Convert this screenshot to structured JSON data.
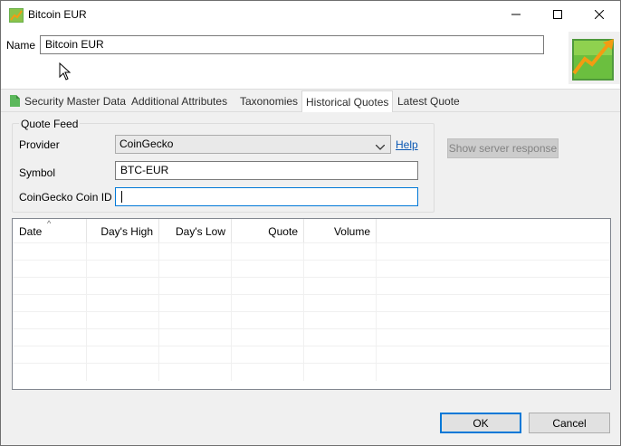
{
  "window": {
    "title": "Bitcoin EUR",
    "app_icon": "chart-icon",
    "controls": [
      "minimize-icon",
      "maximize-icon",
      "close-icon"
    ]
  },
  "header": {
    "name_label": "Name",
    "name_value": "Bitcoin EUR",
    "banner_icon": "chart-trend-icon"
  },
  "tabs": [
    {
      "label": "Security Master Data",
      "icon": "document-icon",
      "active": false
    },
    {
      "label": "Additional Attributes",
      "active": false
    },
    {
      "label": "Taxonomies",
      "active": false
    },
    {
      "label": "Historical Quotes",
      "active": true
    },
    {
      "label": "Latest Quote",
      "active": false
    }
  ],
  "quote_feed": {
    "group_title": "Quote Feed",
    "provider_label": "Provider",
    "provider_value": "CoinGecko",
    "help_link": "Help",
    "symbol_label": "Symbol",
    "symbol_value": "BTC-EUR",
    "coin_id_label": "CoinGecko Coin ID",
    "coin_id_value": "",
    "show_response_button": "Show server response"
  },
  "table": {
    "columns": [
      "Date",
      "Day's High",
      "Day's Low",
      "Quote",
      "Volume"
    ],
    "sorted_column": "Date",
    "rows": []
  },
  "footer": {
    "ok_label": "OK",
    "cancel_label": "Cancel"
  },
  "colors": {
    "accent": "#0078d7",
    "link": "#0a58b4",
    "chart_orange": "#f39c12",
    "chart_green": "#4caf50"
  }
}
